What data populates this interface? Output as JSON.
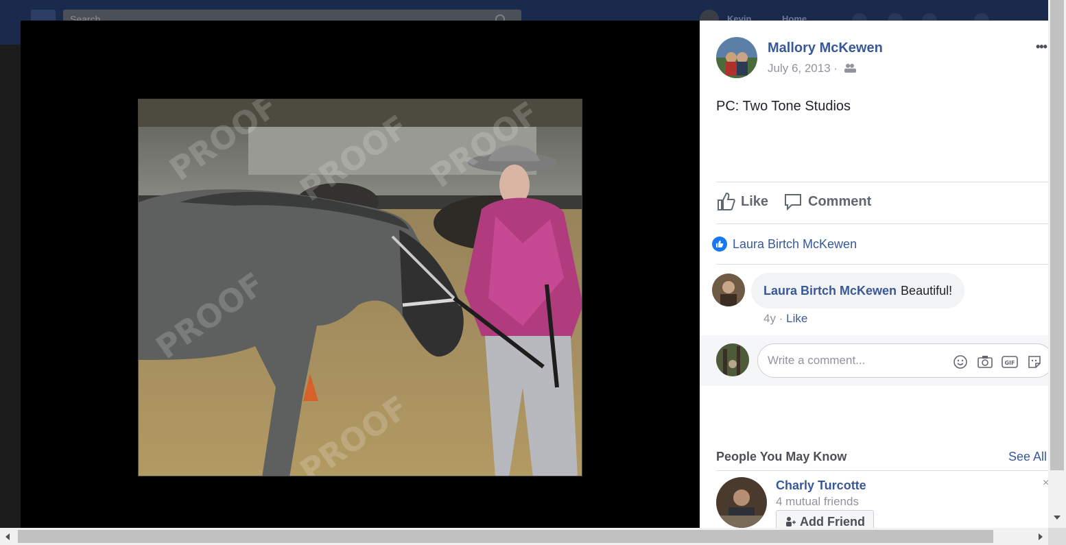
{
  "background": {
    "search_placeholder": "Search",
    "user_name": "Kevin",
    "home_label": "Home"
  },
  "post": {
    "author": "Mallory McKewen",
    "date": "July 6, 2013",
    "date_separator": "·",
    "caption": "PC: Two Tone Studios",
    "more_label": "•••",
    "photo_watermark": "PROOF"
  },
  "actions": {
    "like_label": "Like",
    "comment_label": "Comment"
  },
  "reactions": {
    "names": "Laura Birtch McKewen"
  },
  "comments": [
    {
      "author": "Laura Birtch McKewen",
      "text": "Beautiful!",
      "age": "4y",
      "separator": "·",
      "like_label": "Like"
    }
  ],
  "composer": {
    "placeholder": "Write a comment..."
  },
  "people_you_may_know": {
    "title": "People You May Know",
    "see_all": "See All",
    "people": [
      {
        "name": "Charly Turcotte",
        "mutual": "4 mutual friends",
        "add_label": "Add Friend",
        "close_label": "×"
      }
    ]
  },
  "colors": {
    "link_blue": "#385898",
    "like_blue": "#1877f2",
    "theater_bg": "#000000",
    "panel_bg": "#ffffff"
  }
}
